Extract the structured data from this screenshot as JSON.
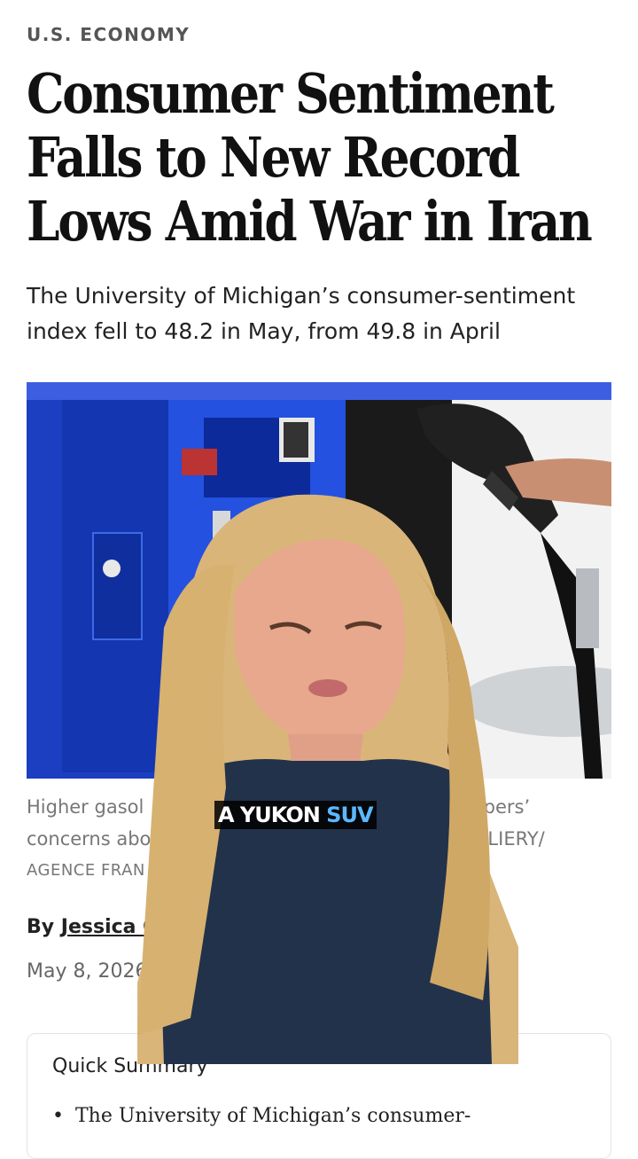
{
  "article": {
    "section": "U.S. ECONOMY",
    "headline": "Consumer Sentiment Falls to New Record Lows Amid War in Iran",
    "dek": "The University of Michigan’s consumer-sentiment index fell to 48.2 in May, from 49.8 in April",
    "caption_line1_start": "Higher gasol",
    "caption_line1_end": "ppers’",
    "caption_line2_start": "concerns abo",
    "caption_line2_end": "LIERY/",
    "caption_credit": "AGENCE FRAN",
    "byline_prefix": "By ",
    "byline_author": "Jessica Co",
    "date": "May 8, 2026"
  },
  "summary": {
    "title": "Quick Summary",
    "bullet": "The University of Michigan’s consumer-"
  },
  "overlay": {
    "subtitle_white": "A YUKON",
    "subtitle_accent": "SUV"
  },
  "colors": {
    "kiosk_blue": "#1f47c9",
    "subtitle_accent": "#5bb8ff"
  }
}
